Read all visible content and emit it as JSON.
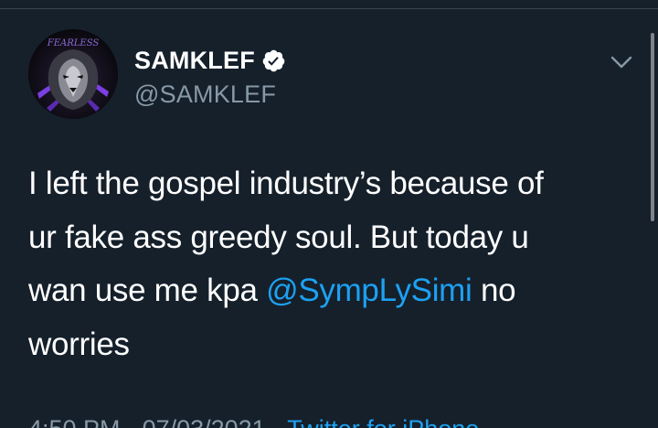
{
  "tweet": {
    "author": {
      "display_name": "SAMKLEF",
      "handle": "@SAMKLEF",
      "verified": true,
      "avatar_text": "FEARLESS"
    },
    "text": {
      "line1": "I left the gospel industry’s because of",
      "line2": "ur fake ass greedy soul. But today u",
      "line3_before": "wan use me kpa ",
      "mention": "@SympLySimi",
      "line3_after": " no",
      "line4": "worries"
    },
    "meta": {
      "time": "4:50 PM",
      "separator": " · ",
      "date": "07/03/2021",
      "source": "Twitter for iPhone"
    }
  },
  "icons": {
    "verified": "verified-badge-icon",
    "menu": "chevron-down-icon"
  },
  "colors": {
    "background": "#15202b",
    "text": "#ffffff",
    "secondary": "#8899a6",
    "accent": "#1da1f2"
  }
}
